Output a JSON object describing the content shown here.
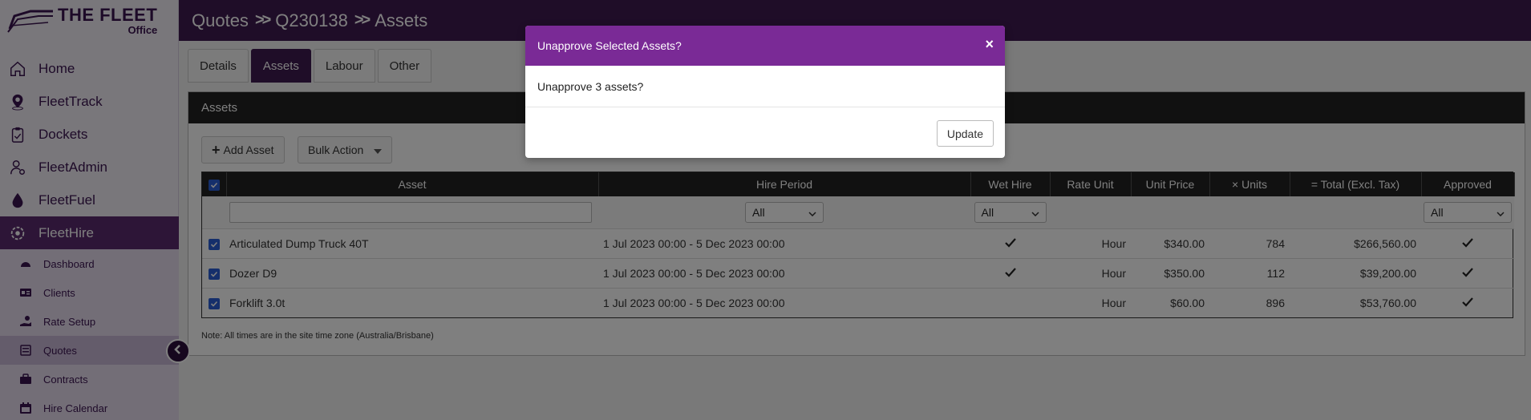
{
  "brand": {
    "line1": "THE FLEET",
    "line2": "Office"
  },
  "sidebar": {
    "items": [
      {
        "label": "Home",
        "icon": "home-icon"
      },
      {
        "label": "FleetTrack",
        "icon": "location-pin-icon"
      },
      {
        "label": "Dockets",
        "icon": "clipboard-check-icon"
      },
      {
        "label": "FleetAdmin",
        "icon": "user-gear-icon"
      },
      {
        "label": "FleetFuel",
        "icon": "fuel-drop-icon"
      },
      {
        "label": "FleetHire",
        "icon": "fleet-gear-icon"
      }
    ],
    "sub_items": [
      {
        "label": "Dashboard",
        "icon": "dashboard-gauge-icon"
      },
      {
        "label": "Clients",
        "icon": "id-card-icon"
      },
      {
        "label": "Rate Setup",
        "icon": "hand-coin-icon"
      },
      {
        "label": "Quotes",
        "icon": "quote-doc-icon"
      },
      {
        "label": "Contracts",
        "icon": "briefcase-icon"
      },
      {
        "label": "Hire Calendar",
        "icon": "calendar-icon"
      }
    ]
  },
  "header": {
    "crumbs": [
      "Quotes",
      "Q230138",
      "Assets"
    ],
    "sep": ">>"
  },
  "tabs": [
    "Details",
    "Assets",
    "Labour",
    "Other"
  ],
  "panel": {
    "title": "Assets",
    "add_button": "Add Asset",
    "add_icon": "+",
    "bulk_button": "Bulk Action",
    "note": "Note: All times are in the site time zone (Australia/Brisbane)"
  },
  "table": {
    "headers": [
      "Asset",
      "Hire Period",
      "Wet Hire",
      "Rate Unit",
      "Unit Price",
      "× Units",
      "= Total (Excl. Tax)",
      "Approved"
    ],
    "filters": {
      "hire_period": "All",
      "wet_hire": "All",
      "approved": "All"
    },
    "rows": [
      {
        "asset": "Articulated Dump Truck 40T",
        "period": "1 Jul 2023 00:00 - 5 Dec 2023 00:00",
        "wet": true,
        "unit": "Hour",
        "price": "$340.00",
        "units": "784",
        "total": "$266,560.00",
        "approved": true
      },
      {
        "asset": "Dozer D9",
        "period": "1 Jul 2023 00:00 - 5 Dec 2023 00:00",
        "wet": true,
        "unit": "Hour",
        "price": "$350.00",
        "units": "112",
        "total": "$39,200.00",
        "approved": true
      },
      {
        "asset": "Forklift 3.0t",
        "period": "1 Jul 2023 00:00 - 5 Dec 2023 00:00",
        "wet": false,
        "unit": "Hour",
        "price": "$60.00",
        "units": "896",
        "total": "$53,760.00",
        "approved": true
      }
    ]
  },
  "modal": {
    "title": "Unapprove Selected Assets?",
    "close": "×",
    "body": "Unapprove 3 assets?",
    "update": "Update"
  },
  "colors": {
    "header_bg": "#3e1a50",
    "modal_header": "#7a2a96",
    "checkbox": "#2a5fd6"
  }
}
